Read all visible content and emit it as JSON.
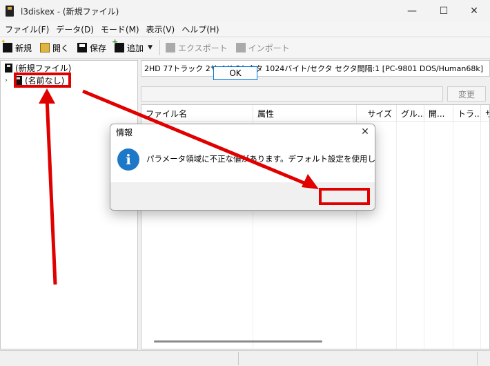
{
  "window": {
    "title": "l3diskex - (新規ファイル)",
    "minimize": "—",
    "maximize": "☐",
    "close": "✕"
  },
  "menu": [
    "ファイル(F)",
    "データ(D)",
    "モード(M)",
    "表示(V)",
    "ヘルプ(H)"
  ],
  "toolbar": {
    "new": "新規",
    "open": "開く",
    "save": "保存",
    "add": "追加",
    "export": "エクスポート",
    "import": "インポート"
  },
  "tree": {
    "root": "(新規ファイル)",
    "child": "(名前なし)"
  },
  "disk_info": "2HD  77トラック 2サイド 8セクタ 1024バイト/セクタ セクタ間隔:1 [PC-9801 DOS/Human68k]",
  "change_button": "変更",
  "columns": [
    "ファイル名",
    "属性",
    "サイズ",
    "グル...",
    "開...",
    "トラ...",
    "サ"
  ],
  "dialog": {
    "title": "情報",
    "close": "✕",
    "icon": "i",
    "message": "パラメータ領域に不正な値があります。デフォルト設定を使用します。",
    "ok": "OK"
  },
  "colors": {
    "annotation": "#e00000",
    "info_icon": "#1e78c8",
    "ok_border": "#0078d4"
  }
}
